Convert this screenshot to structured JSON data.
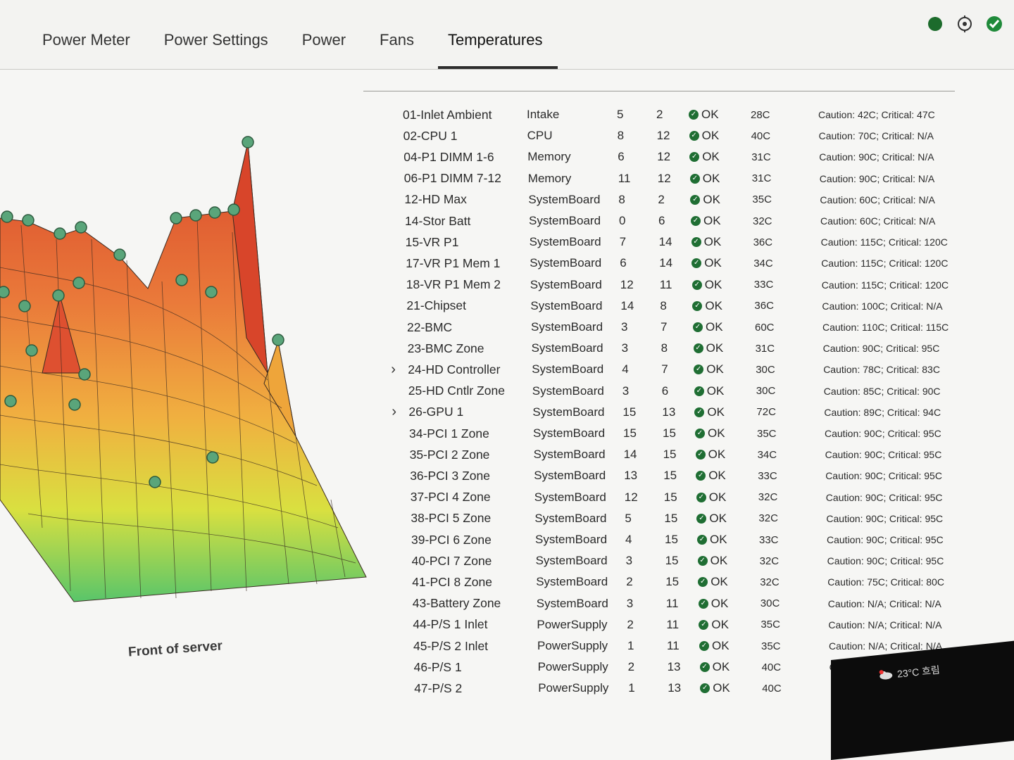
{
  "tabs": [
    {
      "label": "Power Meter"
    },
    {
      "label": "Power Settings"
    },
    {
      "label": "Power"
    },
    {
      "label": "Fans"
    },
    {
      "label": "Temperatures",
      "active": true
    }
  ],
  "header_icons": [
    "power-icon",
    "location-icon",
    "health-ok-icon"
  ],
  "graph": {
    "caption": "Front of server"
  },
  "sensors": [
    {
      "name": "01-Inlet Ambient",
      "location": "Intake",
      "x": "5",
      "y": "2",
      "status": "OK",
      "reading": "28C",
      "thresholds": "Caution: 42C; Critical: 47C"
    },
    {
      "name": "02-CPU 1",
      "location": "CPU",
      "x": "8",
      "y": "12",
      "status": "OK",
      "reading": "40C",
      "thresholds": "Caution: 70C; Critical: N/A"
    },
    {
      "name": "04-P1 DIMM 1-6",
      "location": "Memory",
      "x": "6",
      "y": "12",
      "status": "OK",
      "reading": "31C",
      "thresholds": "Caution: 90C; Critical: N/A"
    },
    {
      "name": "06-P1 DIMM 7-12",
      "location": "Memory",
      "x": "11",
      "y": "12",
      "status": "OK",
      "reading": "31C",
      "thresholds": "Caution: 90C; Critical: N/A"
    },
    {
      "name": "12-HD Max",
      "location": "SystemBoard",
      "x": "8",
      "y": "2",
      "status": "OK",
      "reading": "35C",
      "thresholds": "Caution: 60C; Critical: N/A"
    },
    {
      "name": "14-Stor Batt",
      "location": "SystemBoard",
      "x": "0",
      "y": "6",
      "status": "OK",
      "reading": "32C",
      "thresholds": "Caution: 60C; Critical: N/A"
    },
    {
      "name": "15-VR P1",
      "location": "SystemBoard",
      "x": "7",
      "y": "14",
      "status": "OK",
      "reading": "36C",
      "thresholds": "Caution: 115C; Critical: 120C"
    },
    {
      "name": "17-VR P1 Mem 1",
      "location": "SystemBoard",
      "x": "6",
      "y": "14",
      "status": "OK",
      "reading": "34C",
      "thresholds": "Caution: 115C; Critical: 120C"
    },
    {
      "name": "18-VR P1 Mem 2",
      "location": "SystemBoard",
      "x": "12",
      "y": "11",
      "status": "OK",
      "reading": "33C",
      "thresholds": "Caution: 115C; Critical: 120C"
    },
    {
      "name": "21-Chipset",
      "location": "SystemBoard",
      "x": "14",
      "y": "8",
      "status": "OK",
      "reading": "36C",
      "thresholds": "Caution: 100C; Critical: N/A"
    },
    {
      "name": "22-BMC",
      "location": "SystemBoard",
      "x": "3",
      "y": "7",
      "status": "OK",
      "reading": "60C",
      "thresholds": "Caution: 110C; Critical: 115C"
    },
    {
      "name": "23-BMC Zone",
      "location": "SystemBoard",
      "x": "3",
      "y": "8",
      "status": "OK",
      "reading": "31C",
      "thresholds": "Caution: 90C; Critical: 95C"
    },
    {
      "name": "24-HD Controller",
      "location": "SystemBoard",
      "x": "4",
      "y": "7",
      "status": "OK",
      "reading": "30C",
      "thresholds": "Caution: 78C; Critical: 83C",
      "expandable": true
    },
    {
      "name": "25-HD Cntlr Zone",
      "location": "SystemBoard",
      "x": "3",
      "y": "6",
      "status": "OK",
      "reading": "30C",
      "thresholds": "Caution: 85C; Critical: 90C"
    },
    {
      "name": "26-GPU 1",
      "location": "SystemBoard",
      "x": "15",
      "y": "13",
      "status": "OK",
      "reading": "72C",
      "thresholds": "Caution: 89C; Critical: 94C",
      "expandable": true
    },
    {
      "name": "34-PCI 1 Zone",
      "location": "SystemBoard",
      "x": "15",
      "y": "15",
      "status": "OK",
      "reading": "35C",
      "thresholds": "Caution: 90C; Critical: 95C"
    },
    {
      "name": "35-PCI 2 Zone",
      "location": "SystemBoard",
      "x": "14",
      "y": "15",
      "status": "OK",
      "reading": "34C",
      "thresholds": "Caution: 90C; Critical: 95C"
    },
    {
      "name": "36-PCI 3 Zone",
      "location": "SystemBoard",
      "x": "13",
      "y": "15",
      "status": "OK",
      "reading": "33C",
      "thresholds": "Caution: 90C; Critical: 95C"
    },
    {
      "name": "37-PCI 4 Zone",
      "location": "SystemBoard",
      "x": "12",
      "y": "15",
      "status": "OK",
      "reading": "32C",
      "thresholds": "Caution: 90C; Critical: 95C"
    },
    {
      "name": "38-PCI 5 Zone",
      "location": "SystemBoard",
      "x": "5",
      "y": "15",
      "status": "OK",
      "reading": "32C",
      "thresholds": "Caution: 90C; Critical: 95C"
    },
    {
      "name": "39-PCI 6 Zone",
      "location": "SystemBoard",
      "x": "4",
      "y": "15",
      "status": "OK",
      "reading": "33C",
      "thresholds": "Caution: 90C; Critical: 95C"
    },
    {
      "name": "40-PCI 7 Zone",
      "location": "SystemBoard",
      "x": "3",
      "y": "15",
      "status": "OK",
      "reading": "32C",
      "thresholds": "Caution: 90C; Critical: 95C"
    },
    {
      "name": "41-PCI 8 Zone",
      "location": "SystemBoard",
      "x": "2",
      "y": "15",
      "status": "OK",
      "reading": "32C",
      "thresholds": "Caution: 75C; Critical: 80C"
    },
    {
      "name": "43-Battery Zone",
      "location": "SystemBoard",
      "x": "3",
      "y": "11",
      "status": "OK",
      "reading": "30C",
      "thresholds": "Caution: N/A; Critical: N/A"
    },
    {
      "name": "44-P/S 1 Inlet",
      "location": "PowerSupply",
      "x": "2",
      "y": "11",
      "status": "OK",
      "reading": "35C",
      "thresholds": "Caution: N/A; Critical: N/A"
    },
    {
      "name": "45-P/S 2 Inlet",
      "location": "PowerSupply",
      "x": "1",
      "y": "11",
      "status": "OK",
      "reading": "35C",
      "thresholds": "Caution: N/A; Critical: N/A"
    },
    {
      "name": "46-P/S 1",
      "location": "PowerSupply",
      "x": "2",
      "y": "13",
      "status": "OK",
      "reading": "40C",
      "thresholds": "Caution: N/A; Critical: N/A"
    },
    {
      "name": "47-P/S 2",
      "location": "PowerSupply",
      "x": "1",
      "y": "13",
      "status": "OK",
      "reading": "40C",
      "thresholds": ""
    }
  ],
  "taskbar": {
    "weather": "23°C 흐림"
  }
}
